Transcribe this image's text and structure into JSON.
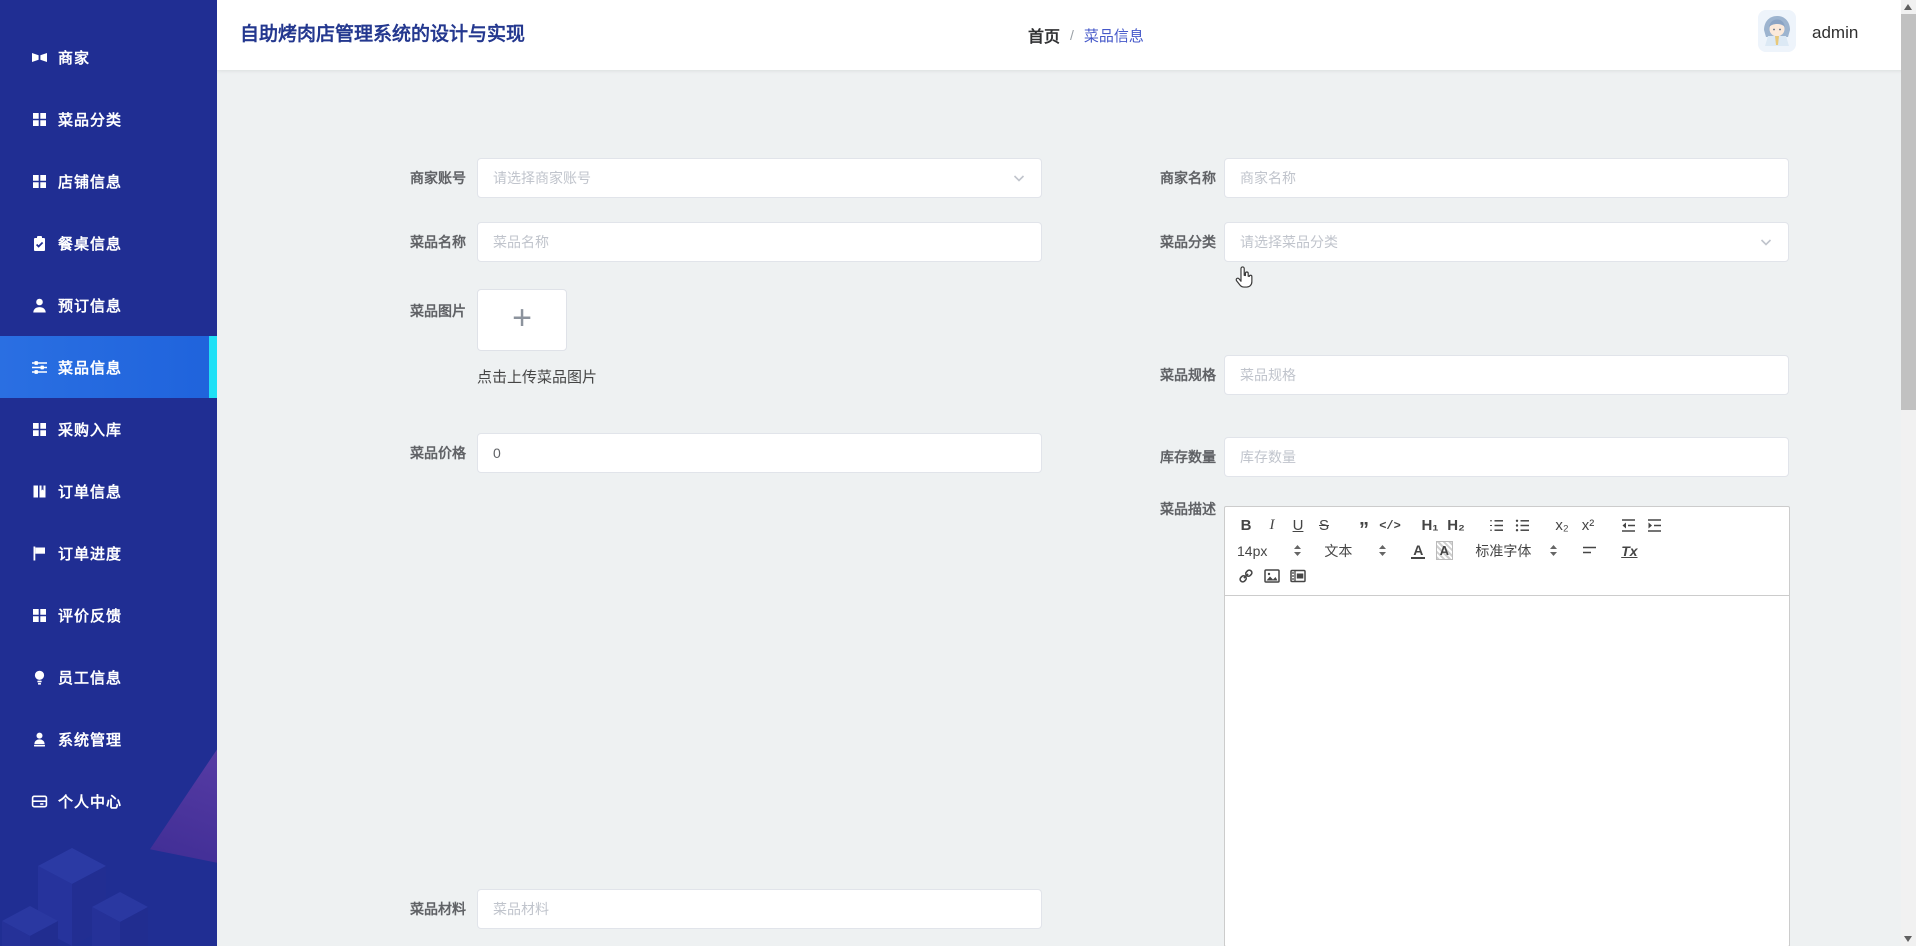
{
  "colors": {
    "sidebar_bg": "#202e93",
    "sidebar_active": "#2066dd",
    "accent_cyan": "#1fe0f6",
    "breadcrumb_link": "#4558c9",
    "title_color": "#24388f"
  },
  "header": {
    "title": "自助烤肉店管理系统的设计与实现",
    "breadcrumb": {
      "home": "首页",
      "separator": "/",
      "current": "菜品信息"
    },
    "user": {
      "name": "admin"
    }
  },
  "sidebar": {
    "active_index": 5,
    "items": [
      {
        "label": "商家",
        "icon": "shop-icon"
      },
      {
        "label": "菜品分类",
        "icon": "grid-icon"
      },
      {
        "label": "店铺信息",
        "icon": "grid-icon"
      },
      {
        "label": "餐桌信息",
        "icon": "clipboard-check-icon"
      },
      {
        "label": "预订信息",
        "icon": "user-icon"
      },
      {
        "label": "菜品信息",
        "icon": "sliders-icon"
      },
      {
        "label": "采购入库",
        "icon": "grid-icon"
      },
      {
        "label": "订单信息",
        "icon": "book-icon"
      },
      {
        "label": "订单进度",
        "icon": "flag-icon"
      },
      {
        "label": "评价反馈",
        "icon": "grid-icon"
      },
      {
        "label": "员工信息",
        "icon": "bulb-icon"
      },
      {
        "label": "系统管理",
        "icon": "user-badge-icon"
      },
      {
        "label": "个人中心",
        "icon": "wallet-icon"
      }
    ]
  },
  "form": {
    "fields": {
      "merchant_account": {
        "label": "商家账号",
        "placeholder": "请选择商家账号"
      },
      "merchant_name": {
        "label": "商家名称",
        "placeholder": "商家名称"
      },
      "dish_name": {
        "label": "菜品名称",
        "placeholder": "菜品名称"
      },
      "dish_category": {
        "label": "菜品分类",
        "placeholder": "请选择菜品分类"
      },
      "dish_image": {
        "label": "菜品图片",
        "plus": "+",
        "upload_hint": "点击上传菜品图片"
      },
      "dish_spec": {
        "label": "菜品规格",
        "placeholder": "菜品规格"
      },
      "dish_price": {
        "label": "菜品价格",
        "value": "0"
      },
      "stock_qty": {
        "label": "库存数量",
        "placeholder": "库存数量"
      },
      "dish_desc": {
        "label": "菜品描述"
      },
      "dish_material": {
        "label": "菜品材料",
        "placeholder": "菜品材料"
      }
    }
  },
  "editor": {
    "bold": "B",
    "italic": "I",
    "underline": "U",
    "strike": "S",
    "blockquote": "”",
    "code": "</>",
    "h1": "H₁",
    "h2": "H₂",
    "subscript": "x₂",
    "superscript": "x²",
    "size_label": "14px",
    "header_label": "文本",
    "font_label": "标准字体",
    "color_label": "A",
    "bg_color_label": "A",
    "clean_label": "Tx"
  }
}
